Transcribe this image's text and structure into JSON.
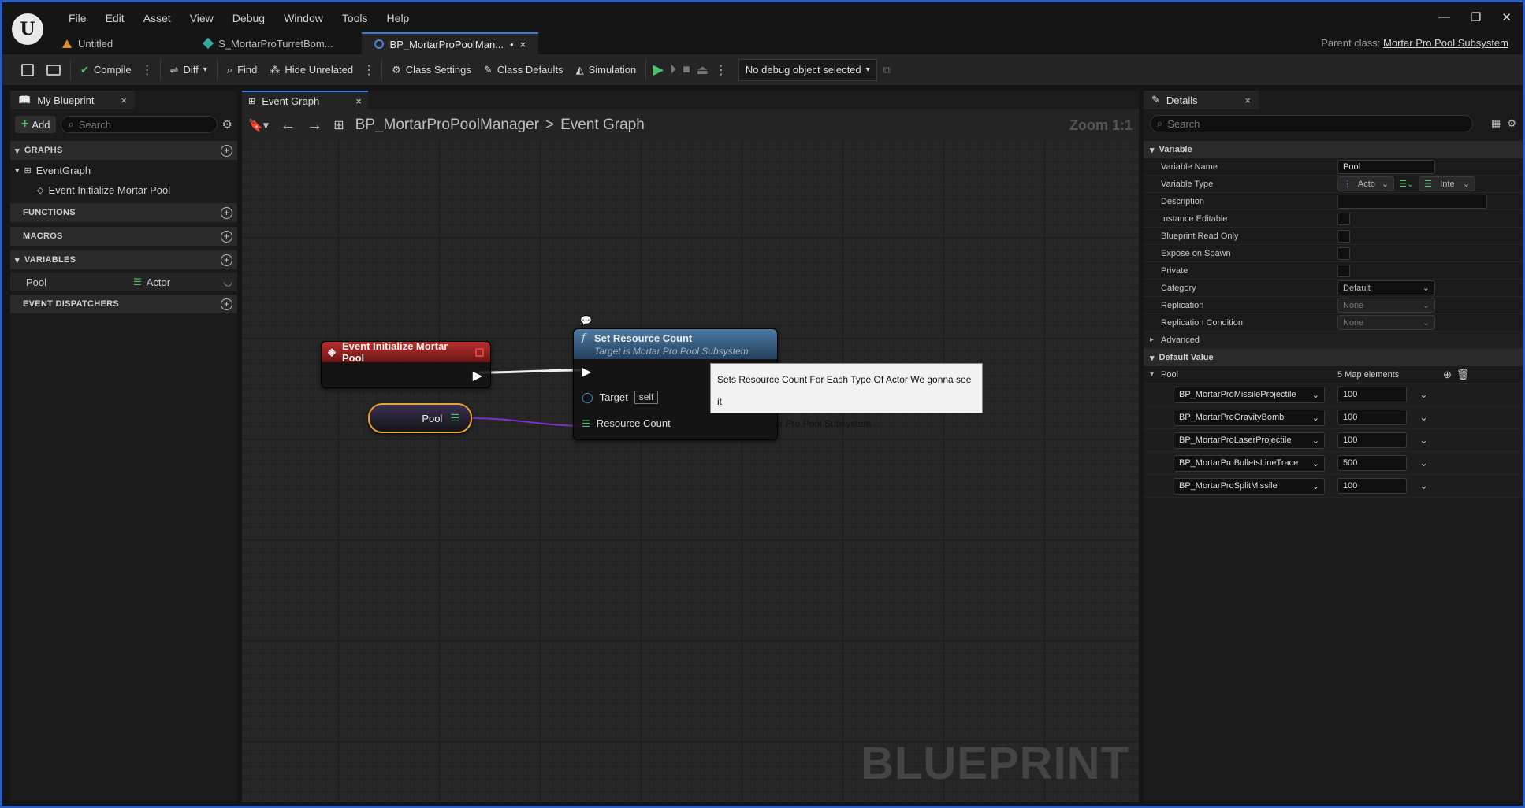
{
  "menu": [
    "File",
    "Edit",
    "Asset",
    "View",
    "Debug",
    "Window",
    "Tools",
    "Help"
  ],
  "doc_tabs": [
    {
      "label": "Untitled"
    },
    {
      "label": "S_MortarProTurretBom..."
    },
    {
      "label": "BP_MortarProPoolMan...",
      "modified": "•",
      "close": "×"
    }
  ],
  "parent_class": {
    "label": "Parent class:",
    "value": "Mortar Pro Pool Subsystem"
  },
  "toolbar": {
    "compile": "Compile",
    "diff": "Diff",
    "find": "Find",
    "hide_unrelated": "Hide Unrelated",
    "class_settings": "Class Settings",
    "class_defaults": "Class Defaults",
    "simulation": "Simulation",
    "debug_object": "No debug object selected"
  },
  "my_blueprint": {
    "tab": "My Blueprint",
    "add": "Add",
    "search_placeholder": "Search",
    "graphs_header": "GRAPHS",
    "event_graph": "EventGraph",
    "event_item": "Event Initialize Mortar Pool",
    "functions_header": "FUNCTIONS",
    "macros_header": "MACROS",
    "variables_header": "VARIABLES",
    "var_name": "Pool",
    "var_type": "Actor",
    "dispatchers_header": "EVENT DISPATCHERS"
  },
  "graph": {
    "tab": "Event Graph",
    "breadcrumb_bp": "BP_MortarProPoolManager",
    "breadcrumb_sep": ">",
    "breadcrumb_graph": "Event Graph",
    "zoom": "Zoom 1:1",
    "watermark": "BLUEPRINT",
    "event_node": "Event Initialize Mortar Pool",
    "func_node_title": "Set Resource Count",
    "func_node_sub": "Target is Mortar Pro Pool Subsystem",
    "pin_target": "Target",
    "pin_target_val": "self",
    "pin_resource": "Resource Count",
    "var_node": "Pool",
    "tooltip_line1": "Sets Resource Count For Each Type Of Actor We gonna see it",
    "tooltip_line2": "Target is Mortar Pro Pool Subsystem"
  },
  "details": {
    "tab": "Details",
    "search_placeholder": "Search",
    "variable_header": "Variable",
    "rows": {
      "variable_name": {
        "label": "Variable Name",
        "value": "Pool"
      },
      "variable_type": {
        "label": "Variable Type",
        "key": "Acto",
        "val": "Inte"
      },
      "description": {
        "label": "Description"
      },
      "instance_editable": {
        "label": "Instance Editable"
      },
      "blueprint_read_only": {
        "label": "Blueprint Read Only"
      },
      "expose_on_spawn": {
        "label": "Expose on Spawn"
      },
      "private": {
        "label": "Private"
      },
      "category": {
        "label": "Category",
        "value": "Default"
      },
      "replication": {
        "label": "Replication",
        "value": "None"
      },
      "replication_condition": {
        "label": "Replication Condition",
        "value": "None"
      }
    },
    "advanced": "Advanced",
    "default_value_header": "Default Value",
    "pool_label": "Pool",
    "pool_count": "5 Map elements",
    "entries": [
      {
        "key": "BP_MortarProMissileProjectile",
        "value": "100"
      },
      {
        "key": "BP_MortarProGravityBomb",
        "value": "100"
      },
      {
        "key": "BP_MortarProLaserProjectile",
        "value": "100"
      },
      {
        "key": "BP_MortarProBulletsLineTrace",
        "value": "500"
      },
      {
        "key": "BP_MortarProSplitMissile",
        "value": "100"
      }
    ]
  },
  "colors": {
    "accent": "#3a7be0",
    "event_header": "#b8302f",
    "function_header": "#4d7aa3",
    "var_border": "#e7a23a",
    "play": "#4cc06a"
  }
}
